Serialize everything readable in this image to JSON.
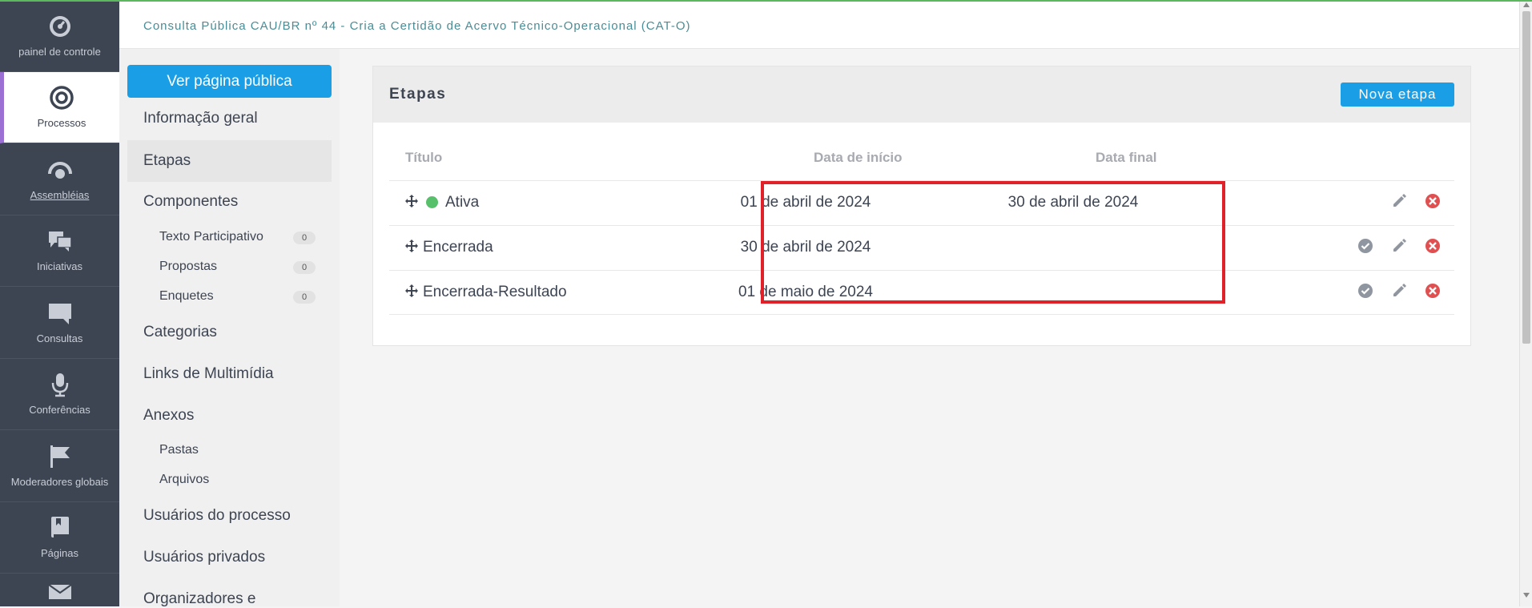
{
  "mainnav": [
    {
      "label": "painel de controle",
      "icon": "dashboard-icon"
    },
    {
      "label": "Processos",
      "icon": "target-icon"
    },
    {
      "label": "Assembléias",
      "icon": "assembly-icon"
    },
    {
      "label": "Iniciativas",
      "icon": "chat-bubbles-icon"
    },
    {
      "label": "Consultas",
      "icon": "speech-bubble-icon"
    },
    {
      "label": "Conferências",
      "icon": "microphone-icon"
    },
    {
      "label": "Moderadores globais",
      "icon": "flag-icon"
    },
    {
      "label": "Páginas",
      "icon": "book-icon"
    }
  ],
  "header": {
    "title": "Consulta Pública CAU/BR nº 44 - Cria a Certidão de Acervo Técnico-Operacional (CAT-O)"
  },
  "subnav": {
    "public_button": "Ver página pública",
    "items": {
      "info": "Informação geral",
      "etapas": "Etapas",
      "componentes": "Componentes",
      "texto": "Texto Participativo",
      "texto_count": "0",
      "propostas": "Propostas",
      "propostas_count": "0",
      "enquetes": "Enquetes",
      "enquetes_count": "0",
      "categorias": "Categorias",
      "links": "Links de Multimídia",
      "anexos": "Anexos",
      "pastas": "Pastas",
      "arquivos": "Arquivos",
      "usuarios_processo": "Usuários do processo",
      "usuarios_privados": "Usuários privados",
      "organizadores": "Organizadores e"
    }
  },
  "main": {
    "title": "Etapas",
    "new_button": "Nova etapa",
    "columns": {
      "title": "Título",
      "start": "Data de início",
      "end": "Data final"
    },
    "rows": [
      {
        "title": "Ativa",
        "start": "01 de abril de 2024",
        "end": "30 de abril de 2024",
        "active": true
      },
      {
        "title": "Encerrada",
        "start": "30 de abril de 2024",
        "end": "",
        "active": false
      },
      {
        "title": "Encerrada-Resultado",
        "start": "01 de maio de 2024",
        "end": "",
        "active": false
      }
    ]
  },
  "colors": {
    "accent": "#1a9fe6",
    "nav_bg": "#3d4452",
    "active_marker": "#9b6fd3",
    "active_dot": "#57c06a",
    "delete": "#e05050",
    "highlight": "#e0212a"
  }
}
